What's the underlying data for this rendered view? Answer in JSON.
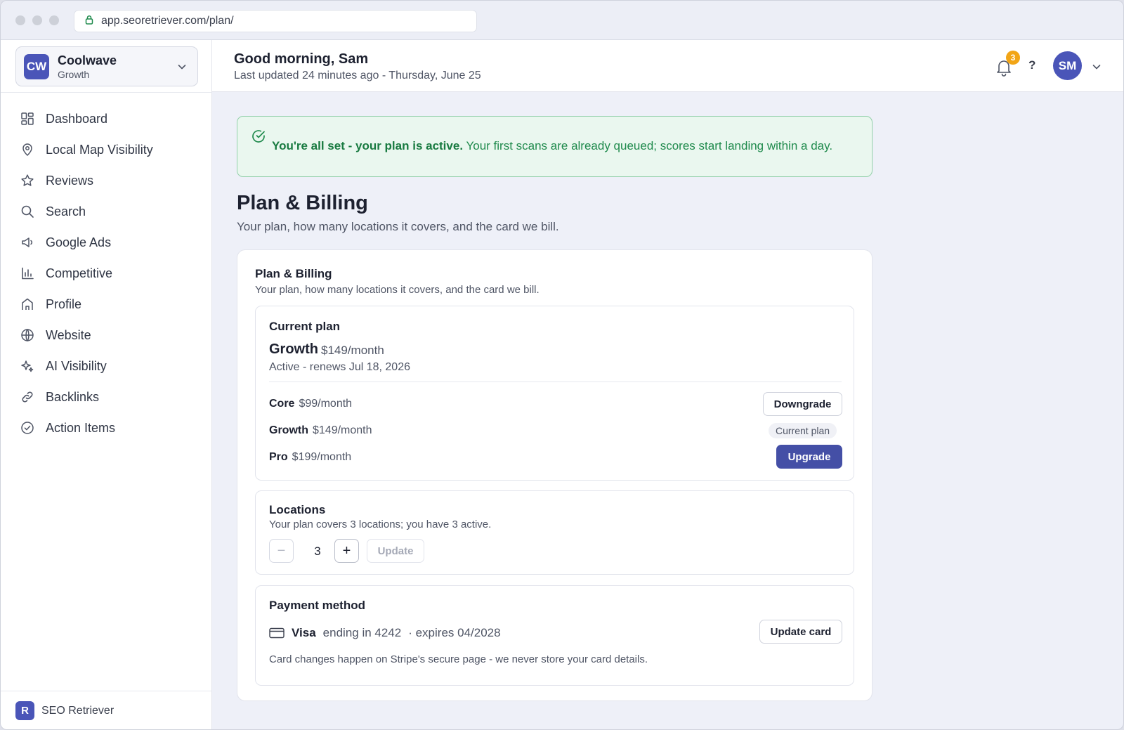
{
  "browser": {
    "url": "app.seoretriever.com/plan/"
  },
  "workspace": {
    "initials": "CW",
    "name": "Coolwave",
    "plan": "Growth"
  },
  "nav": [
    {
      "label": "Dashboard",
      "icon": "dashboard-icon"
    },
    {
      "label": "Local Map Visibility",
      "icon": "map-pin-icon"
    },
    {
      "label": "Reviews",
      "icon": "star-icon"
    },
    {
      "label": "Search",
      "icon": "search-icon"
    },
    {
      "label": "Google Ads",
      "icon": "megaphone-icon"
    },
    {
      "label": "Competitive",
      "icon": "bar-chart-icon"
    },
    {
      "label": "Profile",
      "icon": "storefront-icon"
    },
    {
      "label": "Website",
      "icon": "globe-icon"
    },
    {
      "label": "AI Visibility",
      "icon": "sparkle-icon"
    },
    {
      "label": "Backlinks",
      "icon": "link-icon"
    },
    {
      "label": "Action Items",
      "icon": "check-circle-icon"
    }
  ],
  "brand": {
    "initial": "R",
    "name": "SEO Retriever"
  },
  "header": {
    "greeting": "Good morning, Sam",
    "updated": "Last updated 24 minutes ago - Thursday, June 25",
    "notification_count": "3",
    "help": "?",
    "avatar_initials": "SM"
  },
  "alert": {
    "bold": "You're all set - your plan is active.",
    "text": " Your first scans are already queued; scores start landing within a day."
  },
  "page": {
    "title": "Plan & Billing",
    "subtitle": "Your plan, how many locations it covers, and the card we bill."
  },
  "card": {
    "title": "Plan & Billing",
    "subtitle": "Your plan, how many locations it covers, and the card we bill."
  },
  "current_plan": {
    "heading": "Current plan",
    "name": "Growth",
    "price": "$149/month",
    "status": "Active - renews Jul 18, 2026",
    "tiers": [
      {
        "name": "Core",
        "price": "$99/month",
        "action": "Downgrade"
      },
      {
        "name": "Growth",
        "price": "$149/month",
        "action": "Current plan"
      },
      {
        "name": "Pro",
        "price": "$199/month",
        "action": "Upgrade"
      }
    ]
  },
  "locations": {
    "heading": "Locations",
    "subtitle": "Your plan covers 3 locations; you have 3 active.",
    "minus": "−",
    "quantity": "3",
    "plus": "+",
    "update_label": "Update"
  },
  "payment": {
    "heading": "Payment method",
    "brand": "Visa",
    "ending": "ending in 4242",
    "expires": "· expires 04/2028",
    "update_label": "Update card",
    "note": "Card changes happen on Stripe's secure page - we never store your card details."
  },
  "colors": {
    "accent": "#444fa6",
    "success": "#1f8a4c",
    "badge": "#f2a516"
  }
}
